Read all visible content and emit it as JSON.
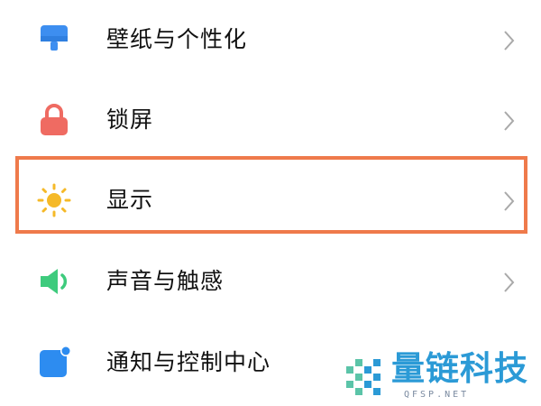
{
  "settings": {
    "items": [
      {
        "label": "壁纸与个性化",
        "icon": "wallpaper-icon",
        "color": "#3d8ef0"
      },
      {
        "label": "锁屏",
        "icon": "lock-icon",
        "color": "#ef6b62"
      },
      {
        "label": "显示",
        "icon": "sun-icon",
        "color": "#f5b928"
      },
      {
        "label": "声音与触感",
        "icon": "speaker-icon",
        "color": "#3ecb7d"
      },
      {
        "label": "通知与控制中心",
        "icon": "notification-icon",
        "color": "#2d8cf0"
      }
    ],
    "highlighted_item": "显示",
    "highlight_color": "#ef7a4b"
  },
  "watermark": {
    "name": "量链科技",
    "url": "QFSP.NET",
    "color": "#2b9ad6"
  }
}
